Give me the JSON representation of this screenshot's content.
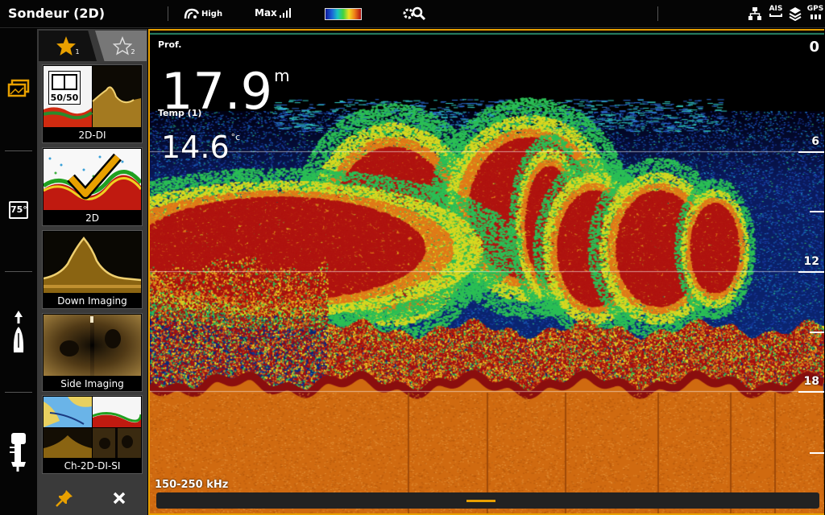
{
  "window": {
    "title": "Sondeur (2D)",
    "sensitivity_label": "High",
    "range_label": "Max",
    "right_icons": [
      "network-icon",
      "ais-icon",
      "layers-icon",
      "gps-icon"
    ],
    "ais_label": "AIS",
    "gps_label": "GPS"
  },
  "rail": {
    "items": [
      {
        "name": "views-icon"
      },
      {
        "name": "temperature-icon",
        "text": "75°"
      },
      {
        "name": "boat-heading-icon"
      },
      {
        "name": "motor-icon"
      }
    ]
  },
  "favorites": {
    "tab1_sub": "1",
    "tab2_sub": "2",
    "items": [
      {
        "label": "2D-DI",
        "badge": "50/50"
      },
      {
        "label": "2D",
        "selected": true
      },
      {
        "label": "Down Imaging"
      },
      {
        "label": "Side Imaging"
      },
      {
        "label": "Ch-2D-DI-SI"
      }
    ]
  },
  "sonar": {
    "depth_label": "Prof.",
    "depth_int": "17",
    "depth_dec": ".9",
    "depth_unit": "m",
    "temp_label": "Temp (1)",
    "temp_int": "14",
    "temp_dec": ".6",
    "temp_unit": "°c",
    "frequency": "150-250 kHz",
    "scale": [
      "0",
      "6",
      "12",
      "18"
    ],
    "colors": {
      "accent": "#e8a000",
      "water": "#0a1a6a",
      "bottom": "#d06a10",
      "strong_echo": "#b01010"
    }
  }
}
